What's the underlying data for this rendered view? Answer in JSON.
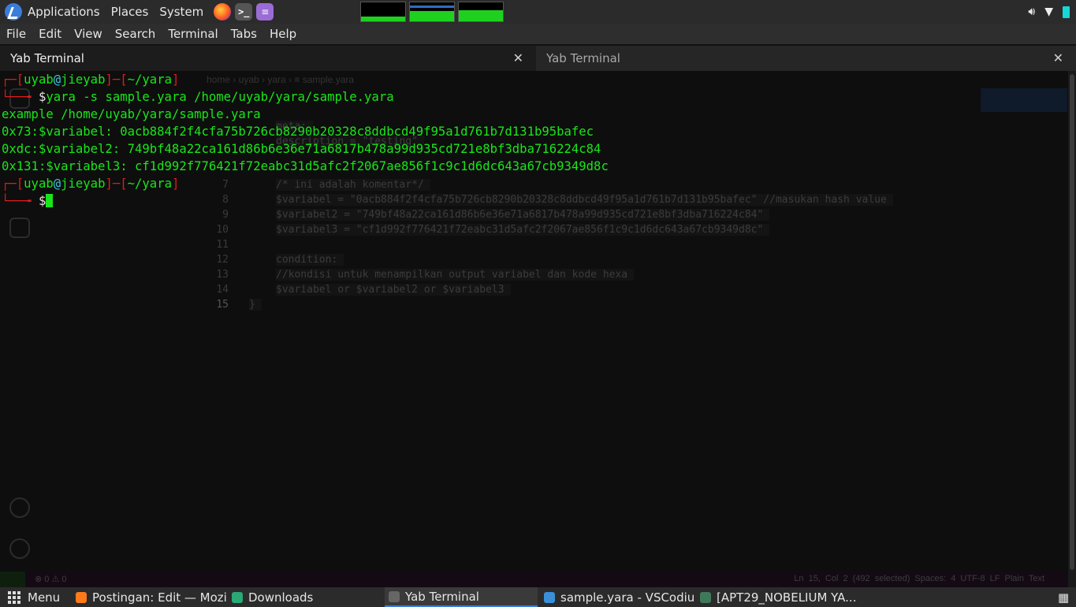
{
  "top_panel": {
    "menus": [
      "Applications",
      "Places",
      "System"
    ],
    "launchers": [
      "firefox-icon",
      "terminal-icon",
      "text-editor-icon"
    ],
    "monitors": [
      {
        "name": "cpu",
        "fill": 0.25
      },
      {
        "name": "memory",
        "fill": 0.55
      },
      {
        "name": "network",
        "fill": 0.6
      }
    ]
  },
  "menubar": [
    "File",
    "Edit",
    "View",
    "Search",
    "Terminal",
    "Tabs",
    "Help"
  ],
  "tabs": [
    {
      "label": "Yab Terminal",
      "active": true
    },
    {
      "label": "Yab Terminal",
      "active": false
    }
  ],
  "terminal": {
    "prompt1": {
      "user": "uyab",
      "host": "jieyab",
      "dir": "~/yara",
      "command": "yara -s sample.yara /home/uyab/yara/sample.yara"
    },
    "output": [
      "example /home/uyab/yara/sample.yara",
      "0x73:$variabel: 0acb884f2f4cfa75b726cb8290b20328c8ddbcd49f95a1d761b7d131b95bafec",
      "0xdc:$variabel2: 749bf48a22ca161d86b6e36e71a6817b478a99d935cd721e8bf3dba716224c84",
      "0x131:$variabel3: cf1d992f776421f72eabc31d5afc2f2067ae856f1c9c1d6dc643a67cb9349d8c"
    ],
    "prompt2": {
      "user": "uyab",
      "host": "jieyab",
      "dir": "~/yara"
    }
  },
  "ghost_editor": {
    "breadcrumb": "home › uyab › yara › ≡ sample.yara",
    "meta_line": "meta:",
    "desc_line": "description = \"testing\"",
    "lines": [
      {
        "n": "7",
        "code": "/* ini adalah komentar*/"
      },
      {
        "n": "8",
        "code": "$variabel = \"0acb884f2f4cfa75b726cb8290b20328c8ddbcd49f95a1d761b7d131b95bafec\" //masukan hash value"
      },
      {
        "n": "9",
        "code": "$variabel2 = \"749bf48a22ca161d86b6e36e71a6817b478a99d935cd721e8bf3dba716224c84\""
      },
      {
        "n": "10",
        "code": "$variabel3 = \"cf1d992f776421f72eabc31d5afc2f2067ae856f1c9c1d6dc643a67cb9349d8c\""
      },
      {
        "n": "11",
        "code": ""
      },
      {
        "n": "12",
        "code": "condition:"
      },
      {
        "n": "13",
        "code": "//kondisi untuk menampilkan output variabel dan kode hexa"
      },
      {
        "n": "14",
        "code": "$variabel or $variabel2 or $variabel3"
      },
      {
        "n": "15",
        "code": "}"
      }
    ],
    "status_left": "⊗ 0 ⚠ 0",
    "status_right": "Ln 15, Col 2 (492 selected)   Spaces: 4   UTF-8   LF   Plain Text"
  },
  "taskbar": {
    "menu_label": "Menu",
    "tasks": [
      {
        "label": "Postingan: Edit — Mozi...",
        "icon": "firefox-icon",
        "color": "#ff7a1a"
      },
      {
        "label": "Downloads",
        "icon": "folder-icon",
        "color": "#2aa876"
      },
      {
        "label": "Yab Terminal",
        "icon": "terminal-icon",
        "color": "#666666",
        "active": true
      },
      {
        "label": "sample.yara - VSCodium",
        "icon": "vscodium-icon",
        "color": "#3a8fd8"
      },
      {
        "label": "[APT29_NOBELIUM YA...",
        "icon": "app-icon",
        "color": "#3e7a5a"
      }
    ]
  }
}
